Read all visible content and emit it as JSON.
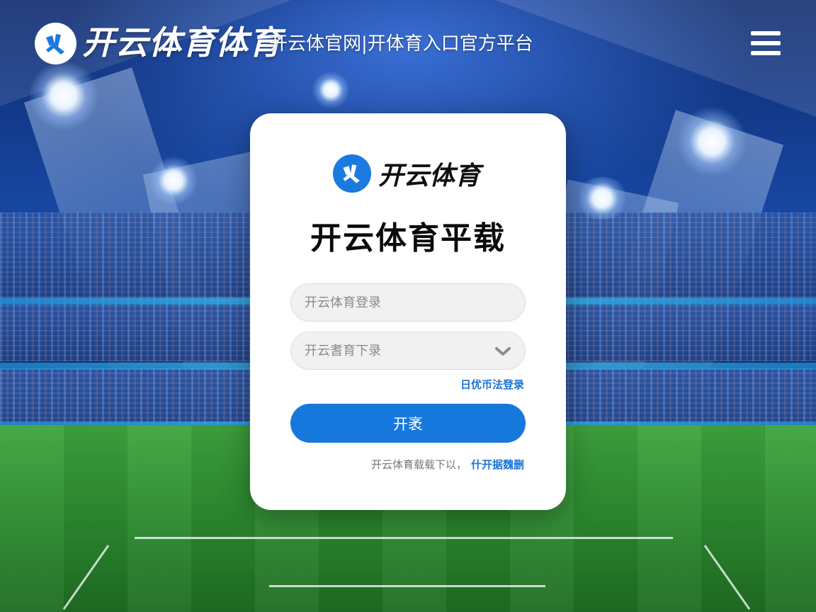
{
  "colors": {
    "accent": "#1677dd",
    "link": "#1a73d6",
    "card_bg": "#ffffff"
  },
  "header": {
    "logo_icon": "brand-logo-icon",
    "brand_title": "开云体育体育",
    "tagline": "开云体官网|开体育入口官方平台",
    "menu_icon": "hamburger-menu-icon"
  },
  "login_card": {
    "logo_icon": "brand-logo-icon",
    "logo_name": "开云体育",
    "title": "开云体育平载",
    "username_placeholder": "开云体育登录",
    "select_placeholder": "开云耆育下录",
    "select_icon": "chevron-down-icon",
    "alt_login_link": "日优币法登录",
    "submit_label": "开袤",
    "footer_text": "开云体育载载下以，",
    "footer_link": "什开据魏删"
  }
}
